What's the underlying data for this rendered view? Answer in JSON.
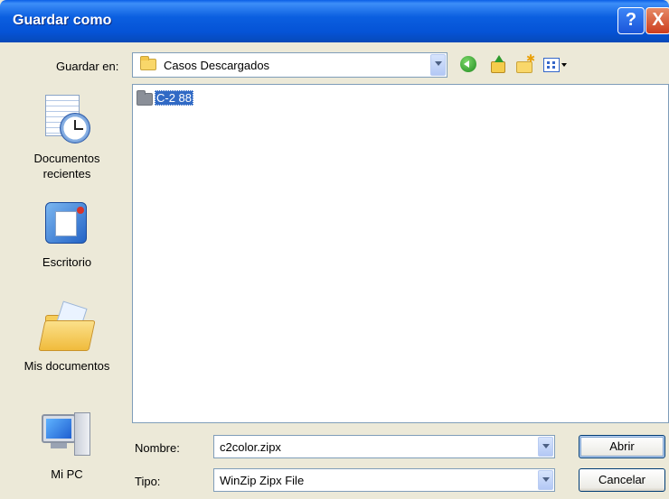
{
  "window": {
    "title": "Guardar como",
    "help_label": "?",
    "close_label": "X"
  },
  "save_in": {
    "label": "Guardar en:",
    "value": "Casos Descargados"
  },
  "places": [
    {
      "label_line1": "Documentos",
      "label_line2": "recientes",
      "icon": "recent-documents-icon"
    },
    {
      "label_line1": "Escritorio",
      "label_line2": "",
      "icon": "desktop-icon"
    },
    {
      "label_line1": "Mis documentos",
      "label_line2": "",
      "icon": "my-documents-icon"
    },
    {
      "label_line1": "Mi PC",
      "label_line2": "",
      "icon": "my-computer-icon"
    }
  ],
  "files": [
    {
      "name": "C-2 88",
      "type": "folder",
      "selected": true
    }
  ],
  "filename": {
    "label": "Nombre:",
    "value": "c2color.zipx"
  },
  "filetype": {
    "label": "Tipo:",
    "value": "WinZip Zipx File"
  },
  "buttons": {
    "open": "Abrir",
    "cancel": "Cancelar"
  },
  "colors": {
    "titlebar": "#0553d6",
    "selection": "#316ac5",
    "dialog_bg": "#ece9d8"
  }
}
